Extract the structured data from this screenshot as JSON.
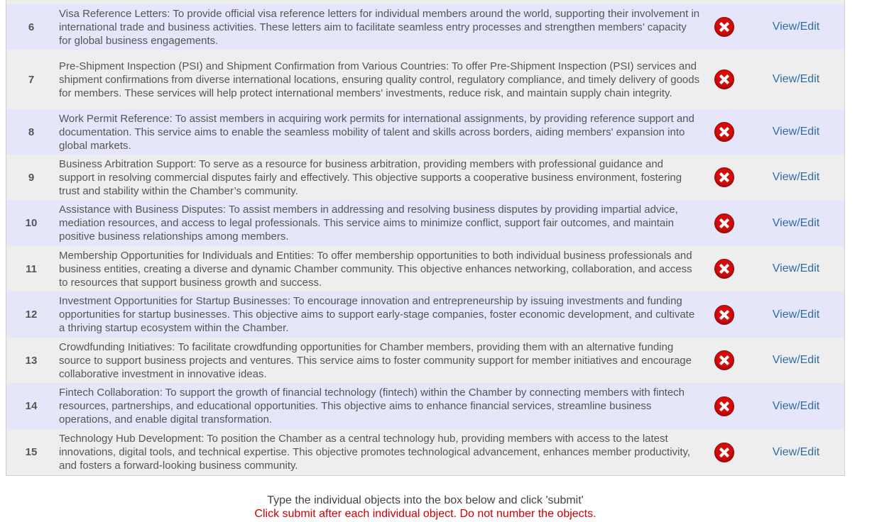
{
  "rows": [
    {
      "num": "6",
      "text": "Visa Reference Letters: To provide official visa reference letters for individual members around the world, supporting their involvement in international trade and business activities. These letters aim to facilitate seamless entry processes and strengthen members’ capacity for global business engagements.",
      "link": "View/Edit"
    },
    {
      "num": "7",
      "text": "Pre-Shipment Inspection (PSI) and Shipment Confirmation from Various Countries: To offer Pre-Shipment Inspection (PSI) services and shipment confirmations from diverse international locations, ensuring quality control, regulatory compliance, and timely delivery of goods for members. These services will help protect international members' investments, reduce risk, and maintain supply chain integrity.",
      "link": "View/Edit"
    },
    {
      "num": "8",
      "text": "Work Permit Reference: To assist members in acquiring work permits for international assignments, by providing reference support and documentation. This service aims to enable the seamless mobility of talent and skills across borders, aiding members' expansion into global markets.",
      "link": "View/Edit"
    },
    {
      "num": "9",
      "text": "Business Arbitration Support: To serve as a resource for business arbitration, providing members with professional guidance and support in resolving commercial disputes fairly and effectively. This objective supports a cooperative business environment, fostering trust and stability within the Chamber’s community.",
      "link": "View/Edit"
    },
    {
      "num": "10",
      "text": "Assistance with Business Disputes: To assist members in addressing and resolving business disputes by providing impartial advice, mediation resources, and access to legal professionals. This service aims to minimize conflict, support fair outcomes, and maintain positive business relationships among members.",
      "link": "View/Edit"
    },
    {
      "num": "11",
      "text": "Membership Opportunities for Individuals and Entities: To offer membership opportunities to both individual business professionals and business entities, creating a diverse and dynamic Chamber community. This objective enhances networking, collaboration, and access to resources that support business growth and success.",
      "link": "View/Edit"
    },
    {
      "num": "12",
      "text": "Investment Opportunities for Startup Businesses: To encourage innovation and entrepreneurship by issuing investments and funding opportunities for startup businesses. This objective aims to support early-stage companies, foster economic development, and cultivate a thriving startup ecosystem within the Chamber.",
      "link": "View/Edit"
    },
    {
      "num": "13",
      "text": "Crowdfunding Initiatives: To facilitate crowdfunding opportunities for Chamber members, providing them with an alternative funding source to support business projects and ventures. This service aims to foster community support for member initiatives and encourage collaborative investment in innovative ideas.",
      "link": "View/Edit"
    },
    {
      "num": "14",
      "text": "Fintech Collaboration: To support the growth of financial technology (fintech) within the Chamber by connecting members with fintech resources, partnerships, and educational opportunities. This objective aims to enhance financial services, streamline business operations, and enable digital transformation.",
      "link": "View/Edit"
    },
    {
      "num": "15",
      "text": "Technology Hub Development: To position the Chamber as a central technology hub, providing members with access to the latest innovations, digital tools, and technical expertise. This objective promotes technological advancement, enhances member productivity, and fosters a forward-looking business community.",
      "link": "View/Edit"
    }
  ],
  "instructions": {
    "main": "Type the individual objects into the box below and click 'submit'",
    "warning": "Click submit after each individual object. Do not number the objects."
  },
  "colors": {
    "row_odd": "#e6e6fa",
    "row_even": "#eeeeee",
    "link": "#2e6da4",
    "delete_icon": "#d40c0c",
    "warning_text": "#cc0000"
  },
  "icons": {
    "delete": "delete-x-icon"
  }
}
